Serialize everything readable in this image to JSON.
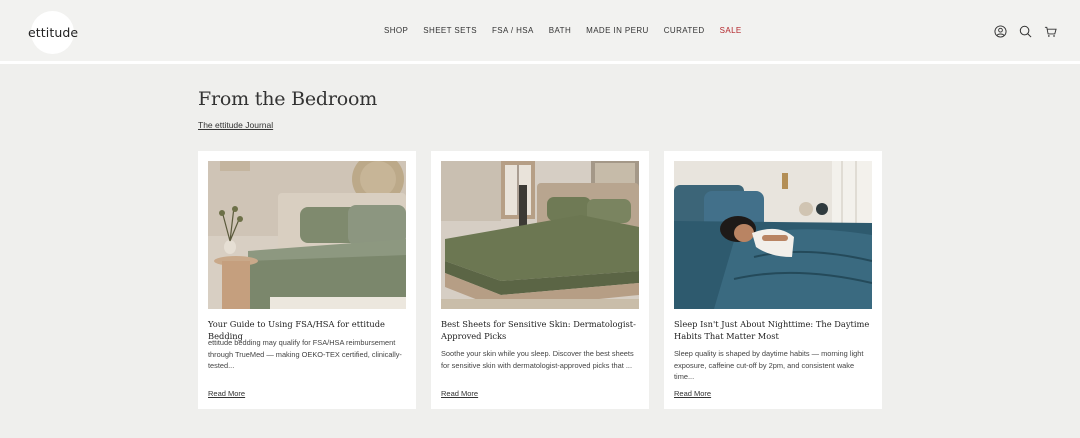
{
  "brand": {
    "logo_text": "ettitude"
  },
  "nav": {
    "items": [
      "SHOP",
      "SHEET SETS",
      "FSA / HSA",
      "BATH",
      "MADE IN PERU",
      "CURATED",
      "SALE"
    ]
  },
  "header_icons": [
    "account-icon",
    "search-icon",
    "cart-icon"
  ],
  "section": {
    "title": "From the Bedroom",
    "link": "The ettitude Journal"
  },
  "cards": [
    {
      "image": "sage-green-bedding-bedroom",
      "title": "Your Guide to Using FSA/HSA for ettitude Bedding",
      "excerpt": "ettitude bedding may qualify for FSA/HSA reimbursement through TrueMed — making OEKO-TEX certified, clinically-tested...",
      "read_more": "Read More"
    },
    {
      "image": "olive-bedding-bed-frame",
      "title": "Best Sheets for Sensitive Skin: Dermatologist-Approved Picks",
      "excerpt": "Soothe your skin while you sleep. Discover the best sheets for sensitive skin with dermatologist-approved picks that ...",
      "read_more": "Read More"
    },
    {
      "image": "woman-sleeping-blue-bedding",
      "title": "Sleep Isn't Just About Nighttime: The Daytime Habits That Matter Most",
      "excerpt": "Sleep quality is shaped by daytime habits — morning light exposure, caffeine cut-off by 2pm, and consistent wake time...",
      "read_more": "Read More"
    }
  ],
  "colors": {
    "page_bg": "#efefed",
    "card_bg": "#ffffff",
    "sale": "#b3262b",
    "text": "#2b2b2b"
  }
}
